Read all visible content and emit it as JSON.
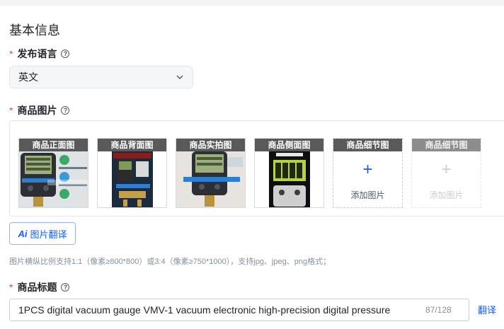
{
  "section": {
    "title": "基本信息"
  },
  "language_field": {
    "label": "发布语言",
    "value": "英文"
  },
  "images_field": {
    "label": "商品图片",
    "images": [
      {
        "caption": "商品正面图"
      },
      {
        "caption": "商品背面图"
      },
      {
        "caption": "商品实拍图"
      },
      {
        "caption": "商品侧面图"
      }
    ],
    "add_slots": [
      {
        "caption": "商品细节图",
        "text": "添加图片"
      },
      {
        "caption": "商品细节图",
        "text": "添加图片"
      }
    ],
    "translate_button": "图片翻译",
    "translate_prefix": "Ai",
    "hint": "图片横纵比例支持1:1（像素≥800*800）或3:4（像素≥750*1000），支持jpg、jpeg、png格式；"
  },
  "title_field": {
    "label": "商品标题",
    "value": "1PCS digital vacuum gauge VMV-1 vacuum electronic high-precision digital pressure",
    "count": "87/128",
    "translate_link": "翻译"
  },
  "icons": {
    "help": "question-circle-icon",
    "dropdown": "chevron-down-icon",
    "add": "plus-icon"
  },
  "colors": {
    "accent": "#165dff",
    "required": "#f53f3f",
    "hint": "#86909c"
  }
}
